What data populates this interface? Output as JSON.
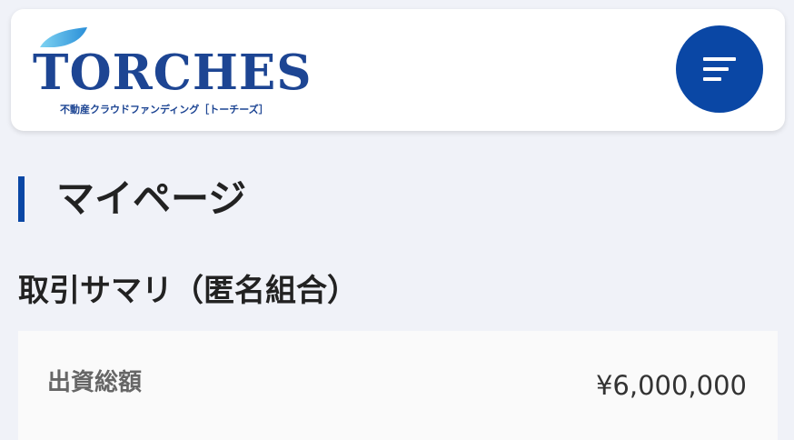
{
  "header": {
    "logo": {
      "wordmark": "TORCHES",
      "tagline": "不動産クラウドファンディング［トーチーズ］"
    },
    "menu_icon": "hamburger-menu-icon"
  },
  "page": {
    "title": "マイページ"
  },
  "summary": {
    "heading": "取引サマリ（匿名組合）",
    "rows": [
      {
        "label": "出資総額",
        "value": "¥6,000,000"
      }
    ]
  },
  "colors": {
    "brand_blue": "#0a47a5",
    "logo_blue": "#1d4593",
    "background": "#f0f2f8"
  }
}
